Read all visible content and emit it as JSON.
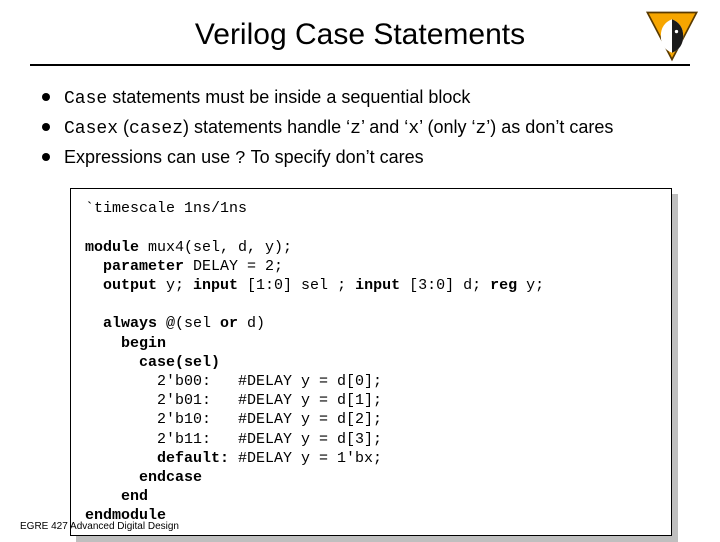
{
  "title": "Verilog Case Statements",
  "bullets": {
    "b1_code": "Case",
    "b1_rest": " statements must be inside a sequential block",
    "b2_code1": "Casex",
    "b2_mid1": " (",
    "b2_code2": "casez",
    "b2_mid2": ") statements handle ‘",
    "b2_code3": "z",
    "b2_mid3": "’ and ‘",
    "b2_code4": "x",
    "b2_mid4": "’ (only ‘",
    "b2_code5": "z",
    "b2_mid5": "’) as don’t cares",
    "b3_pre": "Expressions can use ",
    "b3_code": "?",
    "b3_post": " To specify don’t cares"
  },
  "code": {
    "l0": "`timescale 1ns/1ns",
    "blank1": " ",
    "l1a": "module",
    "l1b": " mux4(sel, d, y);",
    "l2a": "  parameter",
    "l2b": " DELAY = 2;",
    "l3a": "  output",
    "l3b": " y; ",
    "l3c": "input",
    "l3d": " [1:0] sel ; ",
    "l3e": "input",
    "l3f": " [3:0] d; ",
    "l3g": "reg",
    "l3h": " y;",
    "blank2": " ",
    "l4a": "  always",
    "l4b": " @(sel ",
    "l4c": "or",
    "l4d": " d)",
    "l5": "    begin",
    "l6": "      case(sel)",
    "l7": "        2'b00:   #DELAY y = d[0];",
    "l8": "        2'b01:   #DELAY y = d[1];",
    "l9": "        2'b10:   #DELAY y = d[2];",
    "l10": "        2'b11:   #DELAY y = d[3];",
    "l11a": "        default:",
    "l11b": " #DELAY y = 1'bx;",
    "l12": "      endcase",
    "l13": "    end",
    "l14": "endmodule"
  },
  "footer": "EGRE 427 Advanced Digital Design"
}
